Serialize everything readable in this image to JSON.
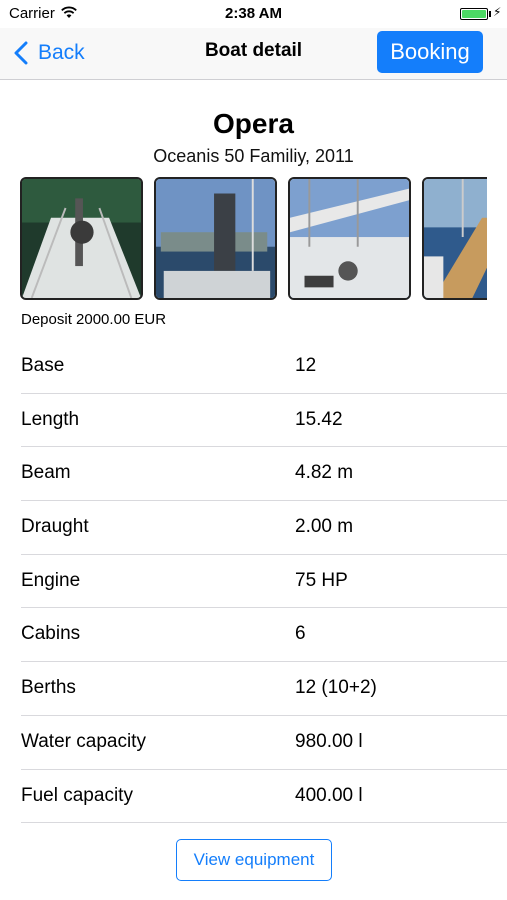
{
  "status_bar": {
    "carrier": "Carrier",
    "time": "2:38 AM",
    "battery_level_percent": 100
  },
  "nav": {
    "back_label": "Back",
    "title": "Boat detail",
    "booking_label": "Booking"
  },
  "boat": {
    "name": "Opera",
    "model": "Oceanis 50 Familiy, 2011",
    "deposit": "Deposit 2000.00 EUR",
    "photo_count_visible": 4
  },
  "specs": [
    {
      "label": "Base",
      "value": "12"
    },
    {
      "label": "Length",
      "value": "15.42"
    },
    {
      "label": "Beam",
      "value": "4.82 m"
    },
    {
      "label": "Draught",
      "value": "2.00 m"
    },
    {
      "label": "Engine",
      "value": "75 HP"
    },
    {
      "label": "Cabins",
      "value": "6"
    },
    {
      "label": "Berths",
      "value": "12 (10+2)"
    },
    {
      "label": "Water capacity",
      "value": "980.00 l"
    },
    {
      "label": "Fuel capacity",
      "value": "400.00 l"
    }
  ],
  "actions": {
    "view_equipment_label": "View equipment"
  },
  "colors": {
    "accent": "#147efb",
    "separator": "#d9d9dd",
    "nav_background": "#f8f8f8"
  }
}
